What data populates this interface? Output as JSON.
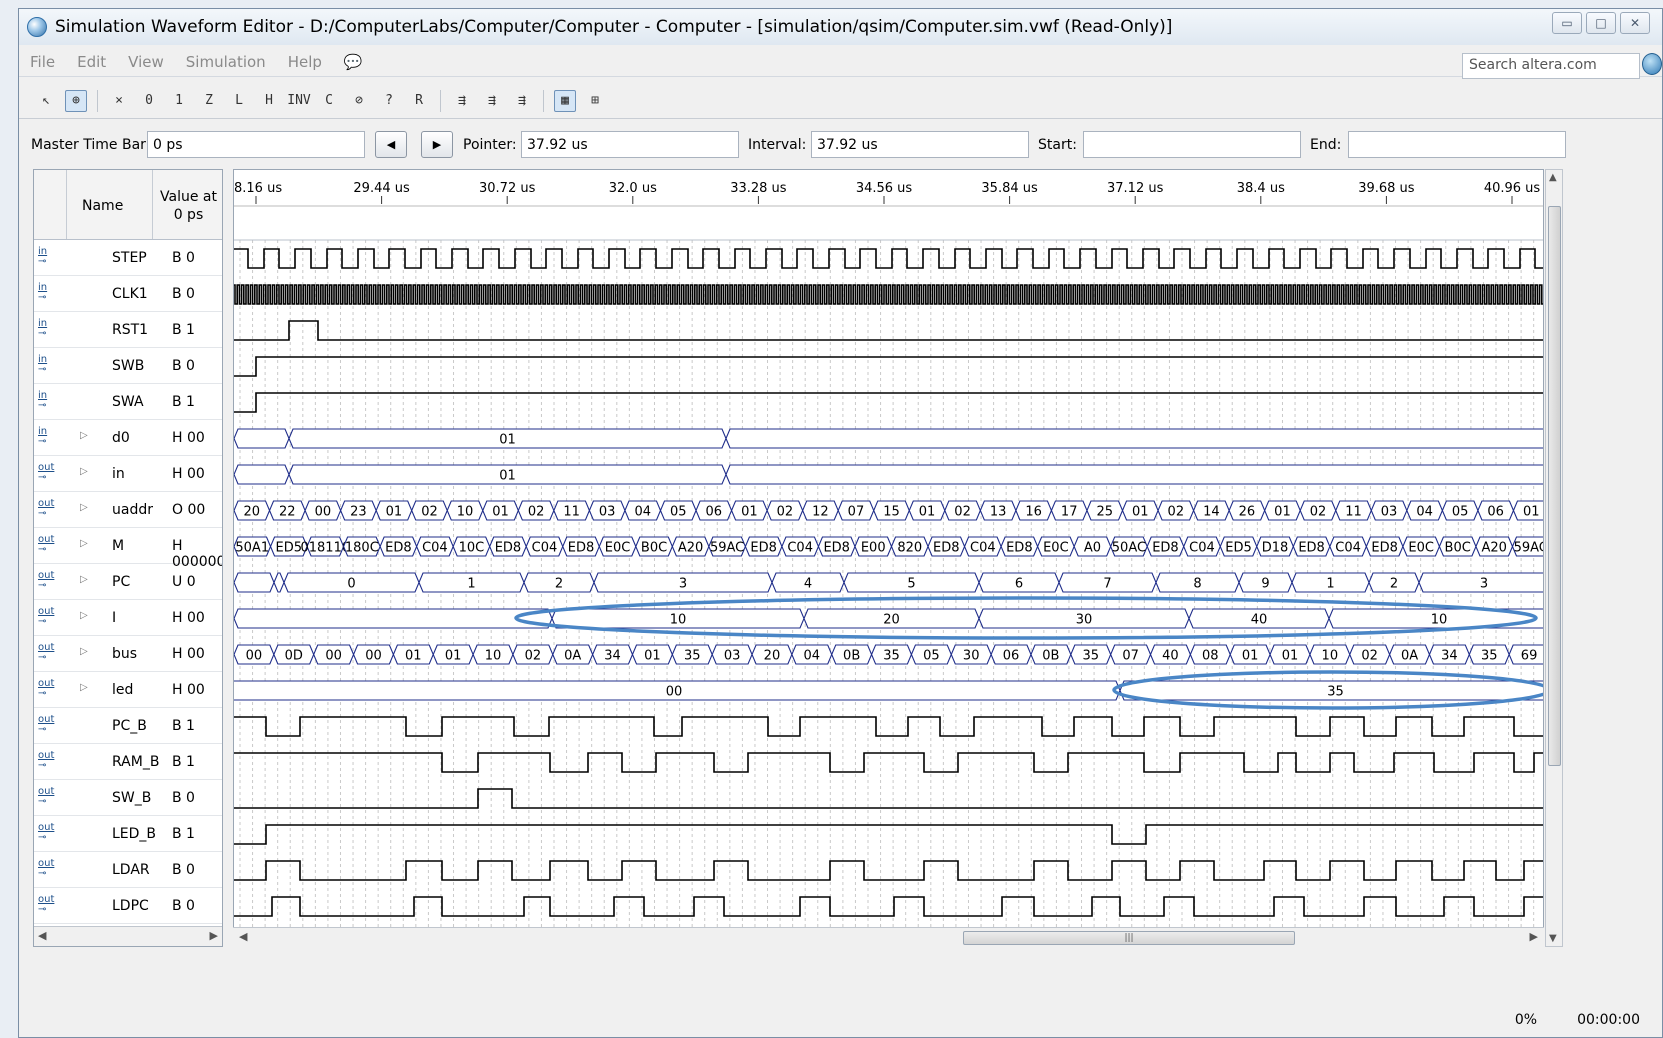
{
  "window": {
    "title": "Simulation Waveform Editor - D:/ComputerLabs/Computer/Computer - Computer - [simulation/qsim/Computer.sim.vwf (Read-Only)]",
    "controls": [
      "▭",
      "□",
      "✕"
    ]
  },
  "menu": [
    "File",
    "Edit",
    "View",
    "Simulation",
    "Help"
  ],
  "search": {
    "placeholder": "Search altera.com"
  },
  "toolbar": {
    "tools": [
      {
        "name": "selection-tool-icon",
        "glyph": "↖"
      },
      {
        "name": "zoom-tool-icon",
        "glyph": "⊕",
        "active": true
      },
      {
        "name": "unknown-value-icon",
        "glyph": "⨯"
      },
      {
        "name": "force-low-icon",
        "glyph": "0"
      },
      {
        "name": "force-high-icon",
        "glyph": "1"
      },
      {
        "name": "high-impedance-icon",
        "glyph": "Z"
      },
      {
        "name": "weak-low-icon",
        "glyph": "L"
      },
      {
        "name": "weak-high-icon",
        "glyph": "H"
      },
      {
        "name": "invert-icon",
        "glyph": "INV"
      },
      {
        "name": "count-value-icon",
        "glyph": "C"
      },
      {
        "name": "clock-value-icon",
        "glyph": "⊘"
      },
      {
        "name": "arbitrary-value-icon",
        "glyph": "?"
      },
      {
        "name": "random-value-icon",
        "glyph": "R"
      },
      {
        "name": "run-functional-icon",
        "glyph": "⇶"
      },
      {
        "name": "run-timing-icon",
        "glyph": "⇶"
      },
      {
        "name": "run-timing-netlist-icon",
        "glyph": "⇶"
      },
      {
        "name": "snap-to-grid-icon",
        "glyph": "▦",
        "active": true
      },
      {
        "name": "grid-icon",
        "glyph": "⊞"
      }
    ]
  },
  "timebar": {
    "master_label": "Master Time Bar:",
    "master_value": "0 ps",
    "pointer_label": "Pointer:",
    "pointer_value": "37.92 us",
    "interval_label": "Interval:",
    "interval_value": "37.92 us",
    "start_label": "Start:",
    "start_value": "",
    "end_label": "End:",
    "end_value": ""
  },
  "table": {
    "name_header": "Name",
    "value_header_line1": "Value at",
    "value_header_line2": "0 ps"
  },
  "ruler": [
    "8.16 us",
    "29.44 us",
    "30.72 us",
    "32.0 us",
    "33.28 us",
    "34.56 us",
    "35.84 us",
    "37.12 us",
    "38.4 us",
    "39.68 us",
    "40.96 us"
  ],
  "signals": [
    {
      "dir": "in",
      "name": "STEP",
      "value": "B 0",
      "bus": false
    },
    {
      "dir": "in",
      "name": "CLK1",
      "value": "B 0",
      "bus": false
    },
    {
      "dir": "in",
      "name": "RST1",
      "value": "B 1",
      "bus": false
    },
    {
      "dir": "in",
      "name": "SWB",
      "value": "B 0",
      "bus": false
    },
    {
      "dir": "in",
      "name": "SWA",
      "value": "B 1",
      "bus": false
    },
    {
      "dir": "in",
      "name": "d0",
      "value": "H 00",
      "bus": true
    },
    {
      "dir": "out",
      "name": "in",
      "value": "H 00",
      "bus": true
    },
    {
      "dir": "out",
      "name": "uaddr",
      "value": "O 00",
      "bus": true
    },
    {
      "dir": "out",
      "name": "M",
      "value": "H 000000",
      "bus": true
    },
    {
      "dir": "out",
      "name": "PC",
      "value": "U 0",
      "bus": true
    },
    {
      "dir": "out",
      "name": "I",
      "value": "H 00",
      "bus": true
    },
    {
      "dir": "out",
      "name": "bus",
      "value": "H 00",
      "bus": true
    },
    {
      "dir": "out",
      "name": "led",
      "value": "H 00",
      "bus": true
    },
    {
      "dir": "out",
      "name": "PC_B",
      "value": "B 1",
      "bus": false
    },
    {
      "dir": "out",
      "name": "RAM_B",
      "value": "B 1",
      "bus": false
    },
    {
      "dir": "out",
      "name": "SW_B",
      "value": "B 0",
      "bus": false
    },
    {
      "dir": "out",
      "name": "LED_B",
      "value": "B 1",
      "bus": false
    },
    {
      "dir": "out",
      "name": "LDAR",
      "value": "B 0",
      "bus": false
    },
    {
      "dir": "out",
      "name": "LDPC",
      "value": "B 0",
      "bus": false
    }
  ],
  "bus_values": {
    "d0": [
      "01"
    ],
    "in": [
      "01"
    ],
    "uaddr": [
      "20",
      "22",
      "00",
      "23",
      "01",
      "02",
      "10",
      "01",
      "02",
      "11",
      "03",
      "04",
      "05",
      "06",
      "01",
      "02",
      "12",
      "07",
      "15",
      "01",
      "02",
      "13",
      "16",
      "17",
      "25",
      "01",
      "02",
      "14",
      "26",
      "01",
      "02",
      "11",
      "03",
      "04",
      "05",
      "06",
      "01"
    ],
    "M": [
      "50A1",
      "ED5",
      "018110",
      "180C",
      "ED8",
      "C04",
      "10C",
      "ED8",
      "C04",
      "ED8",
      "E0C",
      "B0C",
      "A20",
      "59AC",
      "ED8",
      "C04",
      "ED8",
      "E00",
      "820",
      "ED8",
      "C04",
      "ED8",
      "E0C",
      "A0",
      "50AC",
      "ED8",
      "C04",
      "ED5",
      "D18",
      "ED8",
      "C04",
      "ED8",
      "E0C",
      "B0C",
      "A20",
      "59AC"
    ],
    "PC": [
      "0",
      "1",
      "2",
      "3",
      "4",
      "5",
      "6",
      "7",
      "8",
      "9",
      "1",
      "2",
      "3"
    ],
    "I": [
      "10",
      "20",
      "30",
      "40",
      "10"
    ],
    "bus": [
      "00",
      "0D",
      "00",
      "00",
      "01",
      "01",
      "10",
      "02",
      "0A",
      "34",
      "01",
      "35",
      "03",
      "20",
      "04",
      "0B",
      "35",
      "05",
      "30",
      "06",
      "0B",
      "35",
      "07",
      "40",
      "08",
      "01",
      "01",
      "10",
      "02",
      "0A",
      "34",
      "35",
      "69"
    ],
    "led": [
      "00",
      "35"
    ]
  },
  "status": {
    "progress": "0%",
    "elapsed": "00:00:00"
  },
  "annotation_color": "#4a86c6",
  "wave_color": "#1f2d8a"
}
